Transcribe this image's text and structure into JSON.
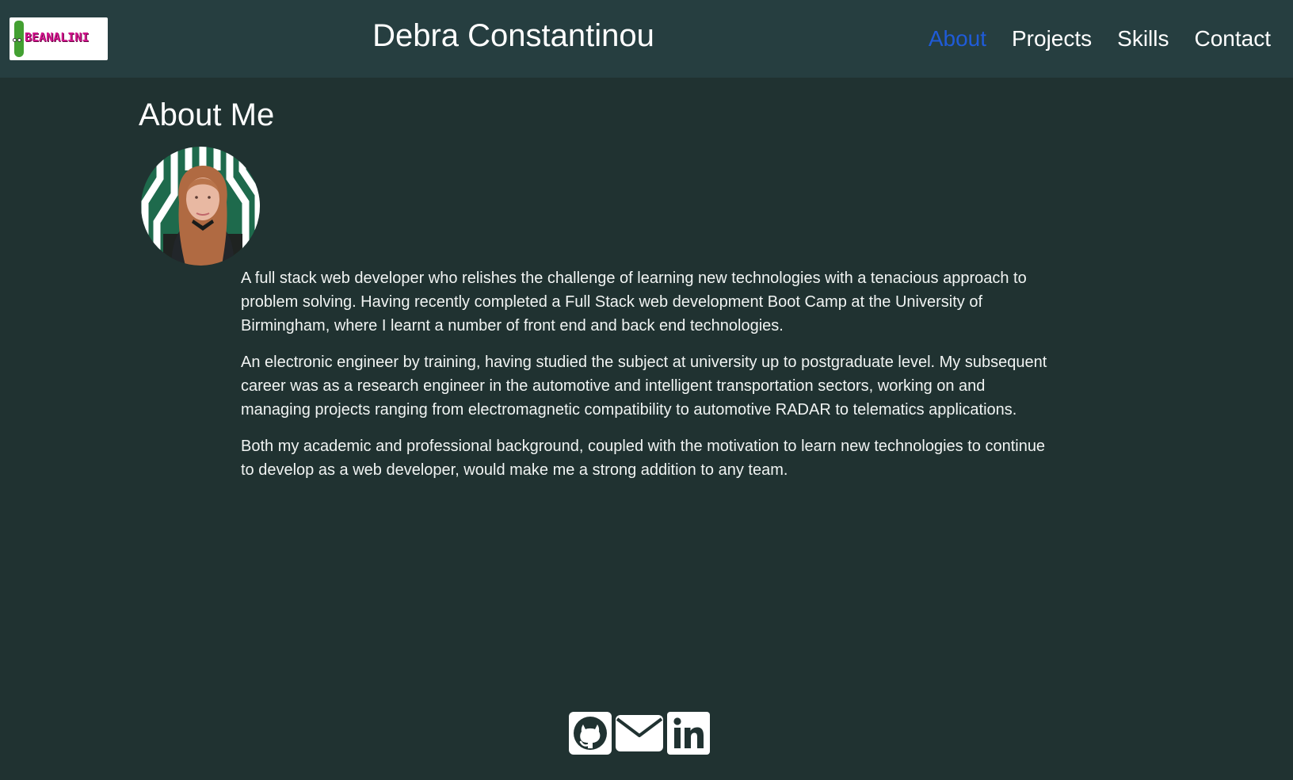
{
  "header": {
    "logo_text": "BEANALINI",
    "title": "Debra Constantinou",
    "nav": [
      {
        "label": "About",
        "active": true
      },
      {
        "label": "Projects",
        "active": false
      },
      {
        "label": "Skills",
        "active": false
      },
      {
        "label": "Contact",
        "active": false
      }
    ]
  },
  "about": {
    "heading": "About Me",
    "paragraphs": [
      "A full stack web developer who relishes the challenge of learning new technologies with a tenacious approach to problem solving. Having recently completed a Full Stack web development Boot Camp at the University of Birmingham, where I learnt a number of front end and back end technologies.",
      "An electronic engineer by training, having studied the subject at university up to postgraduate level. My subsequent career was as a research engineer in the automotive and intelligent transportation sectors, working on and managing projects ranging from electromagnetic compatibility to automotive RADAR to telematics applications.",
      "Both my academic and professional background, coupled with the motivation to learn new technologies to continue to develop as a web developer, would make me a strong addition to any team."
    ]
  },
  "footer": {
    "icons": [
      "github-icon",
      "envelope-icon",
      "linkedin-icon"
    ]
  },
  "colors": {
    "page_background": "#203231",
    "header_background": "#263e40",
    "active_nav": "#1f5bd8",
    "text": "#ffffff"
  }
}
